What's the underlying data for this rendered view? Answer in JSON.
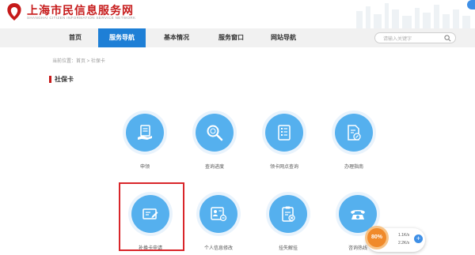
{
  "header": {
    "site_title": "上海市民信息服务网",
    "site_subtitle": "SHANGHAI CITIZEN INFORMATION SERVICE NETWORK"
  },
  "nav": {
    "items": [
      {
        "label": "首页"
      },
      {
        "label": "服务导航"
      },
      {
        "label": "基本情况"
      },
      {
        "label": "服务窗口"
      },
      {
        "label": "网站导航"
      }
    ],
    "active_index": 1,
    "search_placeholder": "请输入关键字"
  },
  "breadcrumb": "当前位置：首页 > 社保卡",
  "section_title": "社保卡",
  "services": [
    {
      "label": "申领",
      "icon": "hand-document-icon"
    },
    {
      "label": "查询进度",
      "icon": "magnifier-icon"
    },
    {
      "label": "领卡网点查询",
      "icon": "list-document-icon"
    },
    {
      "label": "办理指南",
      "icon": "document-compass-icon"
    },
    {
      "label": "补换卡申请",
      "icon": "card-pen-icon"
    },
    {
      "label": "个人信息修改",
      "icon": "id-card-icon"
    },
    {
      "label": "挂失解挂",
      "icon": "clipboard-x-icon"
    },
    {
      "label": "咨询热线",
      "icon": "telephone-icon"
    }
  ],
  "widget": {
    "percent": "80%",
    "upload": "1.1K/s",
    "download": "2.2K/s"
  },
  "colors": {
    "brand_red": "#c61a1a",
    "nav_active": "#1e7fd6",
    "icon_blue": "#55b0ee",
    "highlight_red": "#d9262a"
  }
}
